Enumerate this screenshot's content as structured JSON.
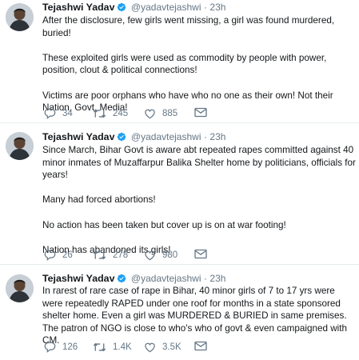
{
  "tweets": [
    {
      "name": "Tejashwi Yadav",
      "handle": "@yadavtejashwi",
      "dot": "·",
      "time": "23h",
      "paragraphs": [
        "After the disclosure, few girls went missing, a girl was found murdered, buried!",
        "These exploited girls were used as commodity by people with power, position, clout & political connections!",
        "Victims are poor orphans who have who no one as their own! Not their Nation, Govt, Media!"
      ],
      "replies": "34",
      "retweets": "245",
      "likes": "885"
    },
    {
      "name": "Tejashwi Yadav",
      "handle": "@yadavtejashwi",
      "dot": "·",
      "time": "23h",
      "paragraphs": [
        "Since March, Bihar Govt is aware abt repeated rapes committed against 40 minor inmates of Muzaffarpur Balika Shelter home by politicians, officials for years!",
        "Many had forced abortions!",
        "No action has been taken but cover up is on at war footing!",
        "Nation has abandoned its girls!"
      ],
      "replies": "26",
      "retweets": "278",
      "likes": "980"
    },
    {
      "name": "Tejashwi Yadav",
      "handle": "@yadavtejashwi",
      "dot": "·",
      "time": "23h",
      "paragraphs": [
        "In rarest of rare case of rape in Bihar, 40 minor girls of 7 to 17 yrs were were repeatedly RAPED under one roof for months in a state sponsored shelter home. Even a girl was MURDERED & BURIED in same premises. The patron of NGO is close to who's who of govt & even campaigned with CM."
      ],
      "replies": "126",
      "retweets": "1.4K",
      "likes": "3.5K"
    }
  ],
  "icons": {
    "reply": "reply-icon",
    "retweet": "retweet-icon",
    "like": "like-icon",
    "message": "message-icon",
    "verified": "verified-badge-icon"
  },
  "colors": {
    "verified": "#1da1f2",
    "icon": "#657786",
    "text": "#14171a",
    "divider": "#e6ecf0"
  }
}
